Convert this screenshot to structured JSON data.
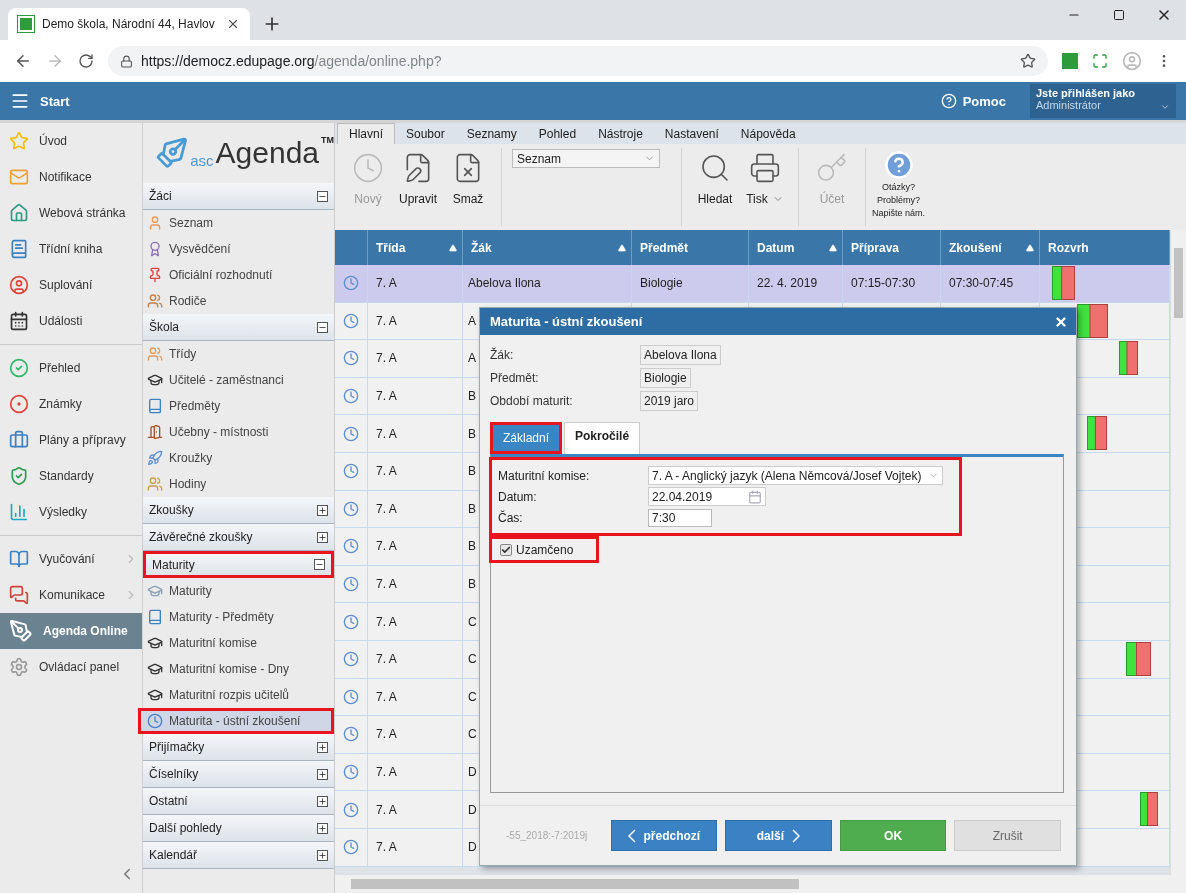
{
  "browser": {
    "tab_title": "Demo škola, Národní 44, Havlov",
    "url_domain": "https://democz.edupage.org",
    "url_path": "/agenda/online.php?"
  },
  "header": {
    "start": "Start",
    "help": "Pomoc",
    "user_caption": "Jste přihlášen jako",
    "user_role": "Administrátor"
  },
  "nav": [
    {
      "label": "Úvod",
      "selected": false,
      "has_submenu": false
    },
    {
      "label": "Notifikace",
      "selected": false,
      "has_submenu": false
    },
    {
      "label": "Webová stránka",
      "selected": false,
      "has_submenu": false
    },
    {
      "label": "Třídní kniha",
      "selected": false,
      "has_submenu": false
    },
    {
      "label": "Suplování",
      "selected": false,
      "has_submenu": false
    },
    {
      "label": "Události",
      "selected": false,
      "has_submenu": false
    },
    {
      "label": "Přehled",
      "selected": false,
      "has_submenu": false
    },
    {
      "label": "Známky",
      "selected": false,
      "has_submenu": false
    },
    {
      "label": "Plány a přípravy",
      "selected": false,
      "has_submenu": false
    },
    {
      "label": "Standardy",
      "selected": false,
      "has_submenu": false
    },
    {
      "label": "Výsledky",
      "selected": false,
      "has_submenu": false
    },
    {
      "label": "Vyučování",
      "selected": false,
      "has_submenu": true
    },
    {
      "label": "Komunikace",
      "selected": false,
      "has_submenu": true
    },
    {
      "label": "Agenda Online",
      "selected": true,
      "has_submenu": false
    },
    {
      "label": "Ovládací panel",
      "selected": false,
      "has_submenu": false
    }
  ],
  "logo": {
    "prefix": "asc",
    "name": "Agenda",
    "mark": "TM"
  },
  "sections": [
    {
      "title": "Žáci",
      "expanded": true,
      "highlighted": false,
      "items": [
        {
          "label": "Seznam",
          "selected": false,
          "highlighted": false
        },
        {
          "label": "Vysvědčení",
          "selected": false,
          "highlighted": false
        },
        {
          "label": "Oficiální rozhodnutí",
          "selected": false,
          "highlighted": false
        },
        {
          "label": "Rodiče",
          "selected": false,
          "highlighted": false
        }
      ]
    },
    {
      "title": "Škola",
      "expanded": true,
      "highlighted": false,
      "items": [
        {
          "label": "Třídy",
          "selected": false,
          "highlighted": false
        },
        {
          "label": "Učitelé - zaměstnanci",
          "selected": false,
          "highlighted": false
        },
        {
          "label": "Předměty",
          "selected": false,
          "highlighted": false
        },
        {
          "label": "Učebny - místnosti",
          "selected": false,
          "highlighted": false
        },
        {
          "label": "Kroužky",
          "selected": false,
          "highlighted": false
        },
        {
          "label": "Hodiny",
          "selected": false,
          "highlighted": false
        }
      ]
    },
    {
      "title": "Zkoušky",
      "expanded": false,
      "highlighted": false
    },
    {
      "title": "Závěrečné zkoušky",
      "expanded": false,
      "highlighted": false
    },
    {
      "title": "Maturity",
      "expanded": true,
      "highlighted": true,
      "items": [
        {
          "label": "Maturity",
          "selected": false,
          "highlighted": false
        },
        {
          "label": "Maturity - Předměty",
          "selected": false,
          "highlighted": false
        },
        {
          "label": "Maturitní komise",
          "selected": false,
          "highlighted": false
        },
        {
          "label": "Maturitní komise - Dny",
          "selected": false,
          "highlighted": false
        },
        {
          "label": "Maturitní rozpis učitelů",
          "selected": false,
          "highlighted": false
        },
        {
          "label": "Maturita - ústní zkoušení",
          "selected": true,
          "highlighted": true
        }
      ]
    },
    {
      "title": "Přijímačky",
      "expanded": false,
      "highlighted": false
    },
    {
      "title": "Číselníky",
      "expanded": false,
      "highlighted": false
    },
    {
      "title": "Ostatní",
      "expanded": false,
      "highlighted": false
    },
    {
      "title": "Další pohledy",
      "expanded": false,
      "highlighted": false
    },
    {
      "title": "Kalendář",
      "expanded": false,
      "highlighted": false
    }
  ],
  "ribbon_tabs": [
    {
      "label": "Hlavní",
      "selected": true
    },
    {
      "label": "Soubor",
      "selected": false
    },
    {
      "label": "Seznamy",
      "selected": false
    },
    {
      "label": "Pohled",
      "selected": false
    },
    {
      "label": "Nástroje",
      "selected": false
    },
    {
      "label": "Nastavení",
      "selected": false
    },
    {
      "label": "Nápověda",
      "selected": false
    }
  ],
  "toolbar": {
    "left": [
      {
        "label": "Nový",
        "disabled": true,
        "dropdown": false
      },
      {
        "label": "Upravit",
        "disabled": false,
        "dropdown": false
      },
      {
        "label": "Smaž",
        "disabled": false,
        "dropdown": false
      }
    ],
    "view_select": "Seznam",
    "right": [
      {
        "label": "Hledat",
        "disabled": false,
        "dropdown": false
      },
      {
        "label": "Tisk",
        "disabled": false,
        "dropdown": true
      },
      {
        "label": "Účet",
        "disabled": true,
        "dropdown": false
      }
    ],
    "help_lines": [
      "Otázky?",
      "Problémy?",
      "Napište nám."
    ]
  },
  "table": {
    "columns": [
      {
        "label": "Třída",
        "sortable": true
      },
      {
        "label": "Žák",
        "sortable": true
      },
      {
        "label": "Předmět",
        "sortable": false
      },
      {
        "label": "Datum",
        "sortable": true
      },
      {
        "label": "Příprava",
        "sortable": false
      },
      {
        "label": "Zkoušení",
        "sortable": true
      },
      {
        "label": "Rozvrh",
        "sortable": false
      }
    ],
    "rows": [
      {
        "selected": true,
        "cells": [
          "7. A",
          "Abelova Ilona",
          "Biologie",
          "22. 4. 2019",
          "07:15-07:30",
          "07:30-07:45"
        ]
      },
      {
        "selected": false,
        "cells": [
          "7. A",
          "A"
        ]
      },
      {
        "selected": false,
        "cells": [
          "7. A",
          "A"
        ]
      },
      {
        "selected": false,
        "cells": [
          "7. A",
          "B"
        ]
      },
      {
        "selected": false,
        "cells": [
          "7. A",
          "B"
        ]
      },
      {
        "selected": false,
        "cells": [
          "7. A",
          "B"
        ]
      },
      {
        "selected": false,
        "cells": [
          "7. A",
          "B"
        ]
      },
      {
        "selected": false,
        "cells": [
          "7. A",
          "B"
        ]
      },
      {
        "selected": false,
        "cells": [
          "7. A",
          "B"
        ]
      },
      {
        "selected": false,
        "cells": [
          "7. A",
          "C"
        ]
      },
      {
        "selected": false,
        "cells": [
          "7. A",
          "C"
        ]
      },
      {
        "selected": false,
        "cells": [
          "7. A",
          "C"
        ]
      },
      {
        "selected": false,
        "cells": [
          "7. A",
          "C"
        ]
      },
      {
        "selected": false,
        "cells": [
          "7. A",
          "D"
        ]
      },
      {
        "selected": false,
        "cells": [
          "7. A",
          "D"
        ]
      },
      {
        "selected": false,
        "cells": [
          "7. A",
          "D"
        ]
      }
    ]
  },
  "dialog": {
    "title": "Maturita - ústní zkoušení",
    "info": [
      {
        "label": "Žák:",
        "value": "Abelova Ilona"
      },
      {
        "label": "Předmět:",
        "value": "Biologie"
      },
      {
        "label": "Období maturit:",
        "value": "2019 jaro"
      }
    ],
    "tabs": [
      {
        "label": "Základní",
        "selected": true,
        "highlighted": true
      },
      {
        "label": "Pokročilé",
        "selected": false,
        "highlighted": false
      }
    ],
    "form": {
      "highlighted": true,
      "fields": [
        {
          "kind": "select",
          "label": "Maturitní komise:",
          "value": "7. A - Anglický jazyk (Alena Němcová/Josef Vojtek)"
        },
        {
          "kind": "date",
          "label": "Datum:",
          "value": "22.04.2019"
        },
        {
          "kind": "time",
          "label": "Čas:",
          "value": "7:30"
        }
      ]
    },
    "locked": {
      "label": "Uzamčeno",
      "checked": true,
      "highlighted": true
    },
    "footer_code": "-55_2018:-7:2019j",
    "buttons": [
      {
        "kind": "prev",
        "label": "předchozí"
      },
      {
        "kind": "next",
        "label": "další"
      },
      {
        "kind": "ok",
        "label": "OK"
      },
      {
        "kind": "cancel",
        "label": "Zrušit"
      }
    ]
  }
}
